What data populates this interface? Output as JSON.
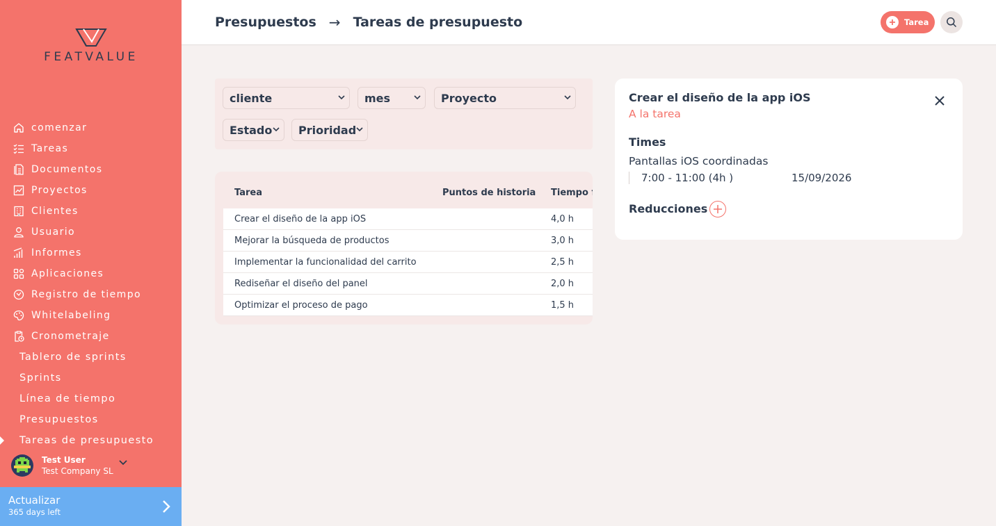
{
  "brand": {
    "name": "FEATVALUE"
  },
  "sidebar": {
    "items": [
      {
        "label": "comenzar",
        "icon": "home-icon"
      },
      {
        "label": "Tareas",
        "icon": "checklist-icon"
      },
      {
        "label": "Documentos",
        "icon": "document-icon"
      },
      {
        "label": "Proyectos",
        "icon": "chart-icon"
      },
      {
        "label": "Clientes",
        "icon": "building-icon"
      },
      {
        "label": "Usuario",
        "icon": "user-icon"
      },
      {
        "label": "Informes",
        "icon": "bars-icon"
      },
      {
        "label": "Aplicaciones",
        "icon": "apps-icon"
      },
      {
        "label": "Registro de tiempo",
        "icon": "timer-icon"
      },
      {
        "label": "Whitelabeling",
        "icon": "palette-icon"
      },
      {
        "label": "Cronometraje",
        "icon": "clipboard-clock-icon"
      }
    ],
    "subitems": [
      {
        "label": "Tablero de sprints"
      },
      {
        "label": "Sprints"
      },
      {
        "label": "Línea de tiempo"
      },
      {
        "label": "Presupuestos"
      },
      {
        "label": "Tareas de presupuesto",
        "active": true
      }
    ],
    "user": {
      "name": "Test User",
      "company": "Test Company SL"
    },
    "upgrade": {
      "title": "Actualizar",
      "days": "365 days left"
    }
  },
  "header": {
    "crumb_parent": "Presupuestos",
    "crumb_separator": "→",
    "crumb_current": "Tareas de presupuesto",
    "add_task_label": "Tarea"
  },
  "filters": {
    "cliente": "cliente",
    "mes": "mes",
    "proyecto": "Proyecto",
    "estado": "Estado",
    "prioridad": "Prioridad"
  },
  "table": {
    "columns": [
      "Tarea",
      "Puntos de historia",
      "Tiempo f"
    ],
    "rows": [
      {
        "task": "Crear el diseño de la app iOS",
        "points": "",
        "time": "4,0 h"
      },
      {
        "task": "Mejorar la búsqueda de productos",
        "points": "",
        "time": "3,0 h"
      },
      {
        "task": "Implementar la funcionalidad del carrito",
        "points": "",
        "time": "2,5 h"
      },
      {
        "task": "Rediseñar el diseño del panel",
        "points": "",
        "time": "2,0 h"
      },
      {
        "task": "Optimizar el proceso de pago",
        "points": "",
        "time": "1,5 h"
      }
    ]
  },
  "detail": {
    "title": "Crear el diseño de la app iOS",
    "link": "A la tarea",
    "times_heading": "Times",
    "entry_name": "Pantallas iOS coordinadas",
    "entry_range": "7:00 - 11:00 (4h )",
    "entry_date": "15/09/2026",
    "reductions_heading": "Reducciones"
  },
  "colors": {
    "accent": "#f4736b",
    "upgrade": "#6aaef2",
    "text": "#2e3b4e",
    "background": "#f6f1f0"
  }
}
